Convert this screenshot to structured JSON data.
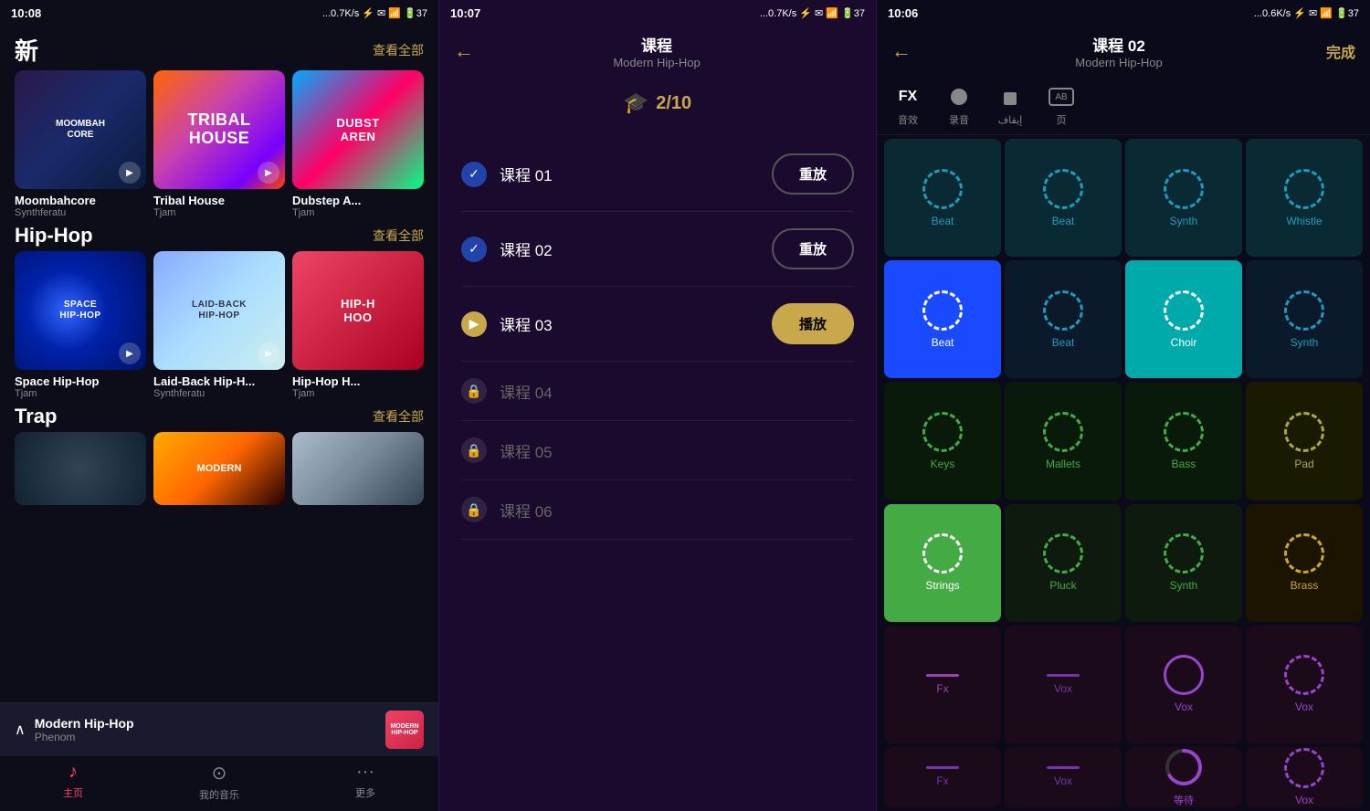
{
  "panel1": {
    "status": {
      "time": "10:08",
      "signal": "...0.7K/s 🔵 ✉ 📶 🔋37"
    },
    "title": "新",
    "view_all": "查看全部",
    "sections": [
      {
        "name": "new_section",
        "cards": [
          {
            "id": "moombahcore",
            "title": "Moombahcore",
            "author": "Synthferatu",
            "thumb_class": "thumb-moombahcore",
            "text": "MOOMBAHCORE"
          },
          {
            "id": "tribal",
            "title": "Tribal House",
            "author": "Tjam",
            "thumb_class": "thumb-tribal",
            "text": "TRIBAL HOUSE"
          },
          {
            "id": "dubstep",
            "title": "Dubstep A...",
            "author": "Tjam",
            "thumb_class": "thumb-dubstep",
            "text": "DUBST AREN"
          }
        ]
      }
    ],
    "hiphop_label": "Hip-Hop",
    "hiphop_view_all": "查看全部",
    "hiphop_cards": [
      {
        "id": "space",
        "title": "Space Hip-Hop",
        "author": "Tjam",
        "thumb_class": "thumb-space",
        "text": "SPACE HIP-HOP"
      },
      {
        "id": "laidback",
        "title": "Laid-Back Hip-H...",
        "author": "Synthferatu",
        "thumb_class": "thumb-laidback",
        "text": "LAID-BACK HIP-HOP"
      },
      {
        "id": "hiphoph",
        "title": "Hip-Hop H...",
        "author": "Tjam",
        "thumb_class": "thumb-hiphop",
        "text": "HIP-H HOO"
      }
    ],
    "trap_label": "Trap",
    "trap_view_all": "查看全部",
    "trap_cards": [
      {
        "id": "trap1",
        "thumb_class": "thumb-trap1"
      },
      {
        "id": "trap2",
        "thumb_class": "thumb-trap2",
        "text": "MODERN"
      },
      {
        "id": "trap3",
        "thumb_class": "thumb-trap3"
      }
    ],
    "now_playing": {
      "title": "Modern Hip-Hop",
      "artist": "Phenom",
      "chevron": "∧"
    },
    "tabs": [
      {
        "id": "home",
        "label": "主页",
        "icon": "♪",
        "active": true
      },
      {
        "id": "music",
        "label": "我的音乐",
        "icon": "⊙",
        "active": false
      },
      {
        "id": "more",
        "label": "更多",
        "icon": "···",
        "active": false
      }
    ]
  },
  "panel2": {
    "status": {
      "time": "10:07",
      "signal": "...0.7K/s"
    },
    "header": {
      "title": "课程",
      "subtitle": "Modern Hip-Hop",
      "back_label": "←"
    },
    "progress": "2/10",
    "courses": [
      {
        "id": "c01",
        "label": "课程 01",
        "status": "completed",
        "btn_label": "重放",
        "btn_active": false
      },
      {
        "id": "c02",
        "label": "课程 02",
        "status": "completed",
        "btn_label": "重放",
        "btn_active": false
      },
      {
        "id": "c03",
        "label": "课程 03",
        "status": "current",
        "btn_label": "播放",
        "btn_active": true
      },
      {
        "id": "c04",
        "label": "课程 04",
        "status": "locked",
        "btn_label": "",
        "btn_active": false
      },
      {
        "id": "c05",
        "label": "课程 05",
        "status": "locked",
        "btn_label": "",
        "btn_active": false
      },
      {
        "id": "c06",
        "label": "课程 06",
        "status": "locked",
        "btn_label": "",
        "btn_active": false
      }
    ]
  },
  "panel3": {
    "status": {
      "time": "10:06",
      "signal": "...0.6K/s"
    },
    "header": {
      "title": "课程 02",
      "subtitle": "Modern Hip-Hop",
      "back_label": "←",
      "done_label": "完成"
    },
    "toolbar": [
      {
        "id": "fx",
        "label": "音效",
        "type": "text",
        "value": "FX"
      },
      {
        "id": "record",
        "label": "录音",
        "type": "circle"
      },
      {
        "id": "stop",
        "label": "إيقاف",
        "type": "square"
      },
      {
        "id": "ab",
        "label": "页",
        "type": "ab"
      }
    ],
    "instruments": [
      {
        "id": "beat1",
        "label": "Beat",
        "row": 1,
        "col": 1,
        "type": "circle",
        "style": "dark-teal"
      },
      {
        "id": "beat2",
        "label": "Beat",
        "row": 1,
        "col": 2,
        "type": "circle",
        "style": "dark-teal"
      },
      {
        "id": "synth1",
        "label": "Synth",
        "row": 1,
        "col": 3,
        "type": "circle",
        "style": "dark-teal"
      },
      {
        "id": "whistle",
        "label": "Whistle",
        "row": 1,
        "col": 4,
        "type": "circle",
        "style": "dark-teal"
      },
      {
        "id": "beat3",
        "label": "Beat",
        "row": 2,
        "col": 1,
        "type": "circle",
        "style": "blue-active"
      },
      {
        "id": "beat4",
        "label": "Beat",
        "row": 2,
        "col": 2,
        "type": "circle",
        "style": "dark-teal2"
      },
      {
        "id": "choir",
        "label": "Choir",
        "row": 2,
        "col": 3,
        "type": "circle",
        "style": "teal-active"
      },
      {
        "id": "synth2",
        "label": "Synth",
        "row": 2,
        "col": 4,
        "type": "circle",
        "style": "dark-teal2"
      },
      {
        "id": "keys",
        "label": "Keys",
        "row": 3,
        "col": 1,
        "type": "circle",
        "style": "dark-green"
      },
      {
        "id": "mallets",
        "label": "Mallets",
        "row": 3,
        "col": 2,
        "type": "circle",
        "style": "dark-green"
      },
      {
        "id": "bass",
        "label": "Bass",
        "row": 3,
        "col": 3,
        "type": "circle",
        "style": "dark-green"
      },
      {
        "id": "pad",
        "label": "Pad",
        "row": 3,
        "col": 4,
        "type": "circle",
        "style": "dark-olive"
      },
      {
        "id": "strings",
        "label": "Strings",
        "row": 4,
        "col": 1,
        "type": "circle",
        "style": "green-active"
      },
      {
        "id": "pluck",
        "label": "Pluck",
        "row": 4,
        "col": 2,
        "type": "circle",
        "style": "dark-green2"
      },
      {
        "id": "synth3",
        "label": "Synth",
        "row": 4,
        "col": 3,
        "type": "circle",
        "style": "dark-green2"
      },
      {
        "id": "brass",
        "label": "Brass",
        "row": 4,
        "col": 4,
        "type": "circle",
        "style": "dark-yellow"
      },
      {
        "id": "fx1",
        "label": "Fx",
        "row": 5,
        "col": 1,
        "type": "dash",
        "style": "dark-purple"
      },
      {
        "id": "vox1",
        "label": "Vox",
        "row": 5,
        "col": 2,
        "type": "dash",
        "style": "purple-vox"
      },
      {
        "id": "vox2",
        "label": "Vox",
        "row": 5,
        "col": 3,
        "type": "circle",
        "style": "purple-circle"
      },
      {
        "id": "vox3",
        "label": "Vox",
        "row": 5,
        "col": 4,
        "type": "circle",
        "style": "purple-circle"
      },
      {
        "id": "fx2",
        "label": "Fx",
        "row": 6,
        "col": 1,
        "type": "dash",
        "style": "dark-r6"
      },
      {
        "id": "vox4",
        "label": "Vox",
        "row": 6,
        "col": 2,
        "type": "dash",
        "style": "dark-r6"
      },
      {
        "id": "loading",
        "label": "等待",
        "row": 6,
        "col": 3,
        "type": "loading",
        "style": "loading"
      },
      {
        "id": "vox5",
        "label": "Vox",
        "row": 6,
        "col": 4,
        "type": "circle",
        "style": "purple-circle"
      }
    ]
  }
}
